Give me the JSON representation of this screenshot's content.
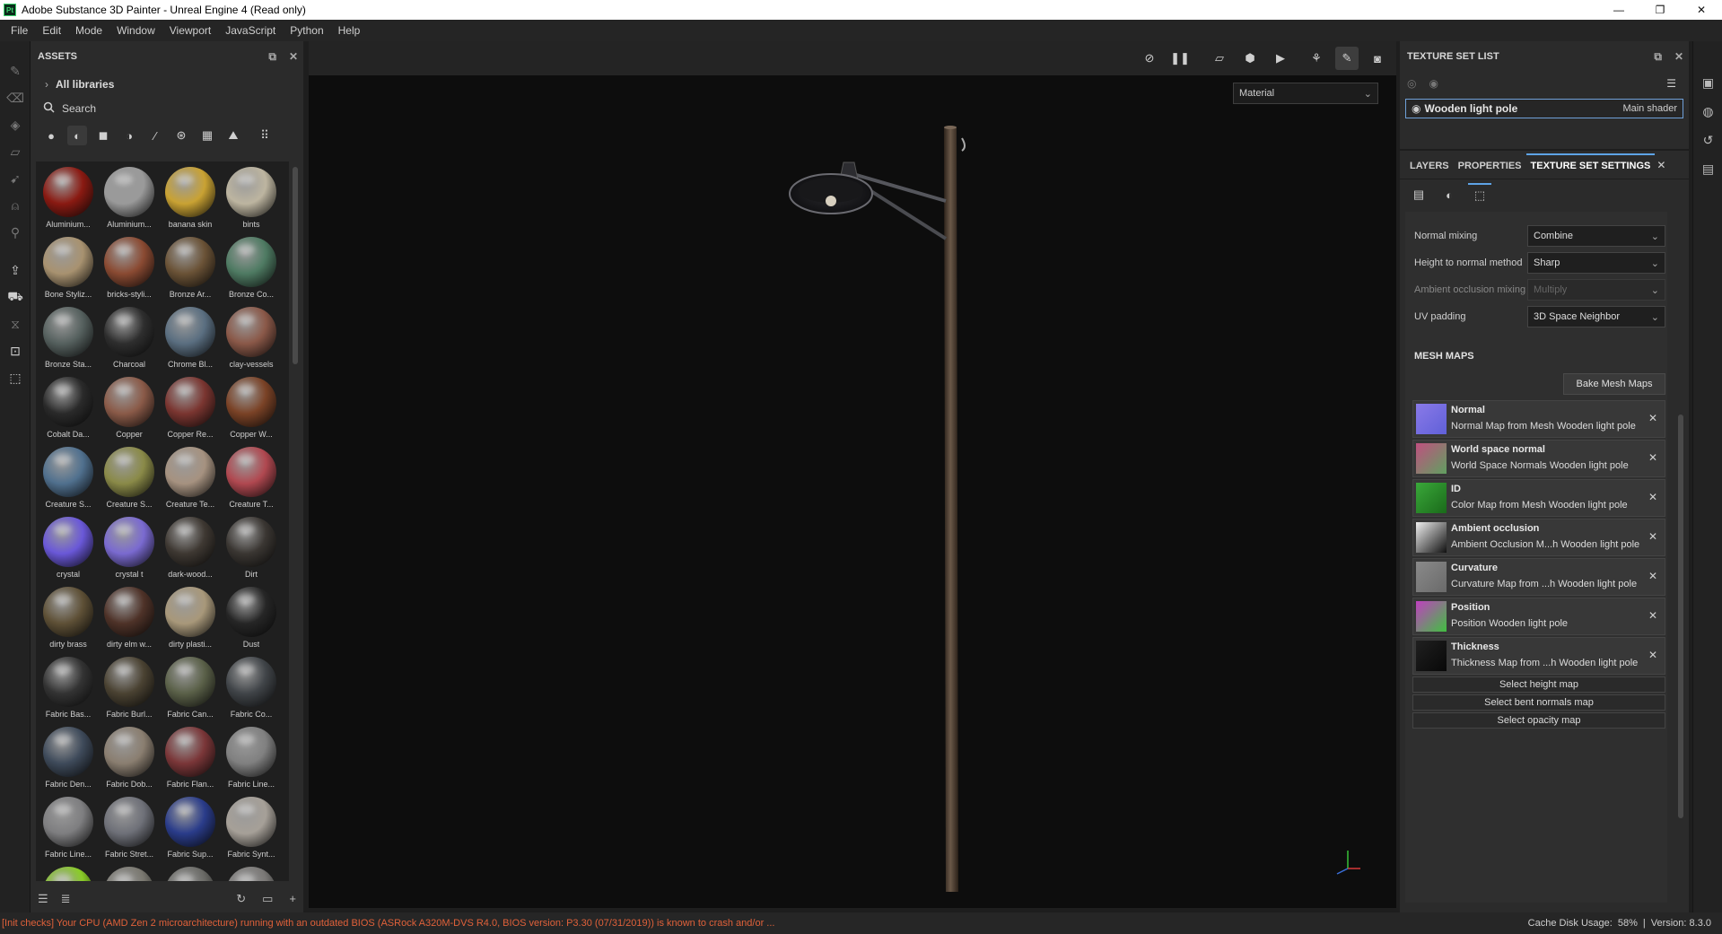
{
  "window": {
    "title": "Adobe Substance 3D Painter - Unreal Engine 4 (Read only)",
    "app_icon": "Pt",
    "controls": [
      "—",
      "❐",
      "✕"
    ]
  },
  "menu": [
    "File",
    "Edit",
    "Mode",
    "Window",
    "Viewport",
    "JavaScript",
    "Python",
    "Help"
  ],
  "assets": {
    "title": "ASSETS",
    "library": "All libraries",
    "search_placeholder": "Search",
    "items": [
      {
        "label": "Aluminium...",
        "color": "#8a1a12"
      },
      {
        "label": "Aluminium...",
        "color": "#9a9a9a"
      },
      {
        "label": "banana skin",
        "color": "#c9a233"
      },
      {
        "label": "bints",
        "color": "#bdb5a0"
      },
      {
        "label": "Bone Styliz...",
        "color": "#a89270"
      },
      {
        "label": "bricks-styli...",
        "color": "#8a4a32"
      },
      {
        "label": "Bronze Ar...",
        "color": "#6a5236"
      },
      {
        "label": "Bronze Co...",
        "color": "#4e7a62"
      },
      {
        "label": "Bronze Sta...",
        "color": "#55605e"
      },
      {
        "label": "Charcoal",
        "color": "#2e2e2e"
      },
      {
        "label": "Chrome Bl...",
        "color": "#5a6e80"
      },
      {
        "label": "clay-vessels",
        "color": "#8a5848"
      },
      {
        "label": "Cobalt Da...",
        "color": "#2a2a2a"
      },
      {
        "label": "Copper",
        "color": "#8a5a48"
      },
      {
        "label": "Copper Re...",
        "color": "#7a3530"
      },
      {
        "label": "Copper W...",
        "color": "#7a4226"
      },
      {
        "label": "Creature S...",
        "color": "#50708e"
      },
      {
        "label": "Creature S...",
        "color": "#8a8a48"
      },
      {
        "label": "Creature Te...",
        "color": "#a69280"
      },
      {
        "label": "Creature T...",
        "color": "#b04850"
      },
      {
        "label": "crystal",
        "color": "#6a58d8"
      },
      {
        "label": "crystal t",
        "color": "#7a6ad0"
      },
      {
        "label": "dark-wood...",
        "color": "#3e3832"
      },
      {
        "label": "Dirt",
        "color": "#3a3632"
      },
      {
        "label": "dirty brass",
        "color": "#5e5036"
      },
      {
        "label": "dirty elm w...",
        "color": "#4e3228"
      },
      {
        "label": "dirty plasti...",
        "color": "#a8987a"
      },
      {
        "label": "Dust",
        "color": "#262626"
      },
      {
        "label": "Fabric Bas...",
        "color": "#333333"
      },
      {
        "label": "Fabric Burl...",
        "color": "#4a4232"
      },
      {
        "label": "Fabric Can...",
        "color": "#5a6048"
      },
      {
        "label": "Fabric Co...",
        "color": "#404448"
      },
      {
        "label": "Fabric Den...",
        "color": "#3e4a5a"
      },
      {
        "label": "Fabric Dob...",
        "color": "#8a7e70"
      },
      {
        "label": "Fabric Flan...",
        "color": "#7a3638"
      },
      {
        "label": "Fabric Line...",
        "color": "#808080"
      },
      {
        "label": "Fabric Line...",
        "color": "#7e7e80"
      },
      {
        "label": "Fabric Stret...",
        "color": "#6e7078"
      },
      {
        "label": "Fabric Sup...",
        "color": "#2a3c8a"
      },
      {
        "label": "Fabric Synt...",
        "color": "#a6a098"
      },
      {
        "label": "",
        "color": "#8acc28"
      },
      {
        "label": "",
        "color": "#7a7870"
      },
      {
        "label": "",
        "color": "#6a6a66"
      },
      {
        "label": "",
        "color": "#7a7876"
      }
    ]
  },
  "viewport": {
    "mode_select": "Material"
  },
  "texture_set_list": {
    "title": "TEXTURE SET LIST",
    "item_name": "Wooden light pole",
    "item_shader": "Main shader"
  },
  "tabs": {
    "layers": "LAYERS",
    "properties": "PROPERTIES",
    "texture_set_settings": "TEXTURE SET SETTINGS",
    "close": "✕"
  },
  "settings": {
    "normal_mixing": {
      "label": "Normal mixing",
      "value": "Combine"
    },
    "height_to_normal": {
      "label": "Height to normal method",
      "value": "Sharp"
    },
    "ao_mixing": {
      "label": "Ambient occlusion mixing",
      "value": "Multiply"
    },
    "uv_padding": {
      "label": "UV padding",
      "value": "3D Space Neighbor"
    }
  },
  "mesh_maps": {
    "title": "MESH MAPS",
    "bake_button": "Bake Mesh Maps",
    "items": [
      {
        "name": "Normal",
        "desc": "Normal Map from Mesh Wooden light pole"
      },
      {
        "name": "World space normal",
        "desc": "World Space Normals Wooden light pole"
      },
      {
        "name": "ID",
        "desc": "Color Map from Mesh Wooden light pole"
      },
      {
        "name": "Ambient occlusion",
        "desc": "Ambient Occlusion M...h Wooden light pole"
      },
      {
        "name": "Curvature",
        "desc": "Curvature Map from ...h Wooden light pole"
      },
      {
        "name": "Position",
        "desc": "Position Wooden light pole"
      },
      {
        "name": "Thickness",
        "desc": "Thickness Map from ...h Wooden light pole"
      }
    ],
    "select_height": "Select height map",
    "select_bent": "Select bent normals map",
    "select_opacity": "Select opacity map"
  },
  "status": {
    "warning": "[Init checks] Your CPU (AMD Zen 2 microarchitecture) running with an outdated BIOS (ASRock A320M-DVS R4.0, BIOS version: P3.30 (07/31/2019)) is known to crash and/or ...",
    "cache": "Cache Disk Usage:",
    "cache_value": "58%",
    "separator": "|",
    "version": "Version: 8.3.0"
  }
}
